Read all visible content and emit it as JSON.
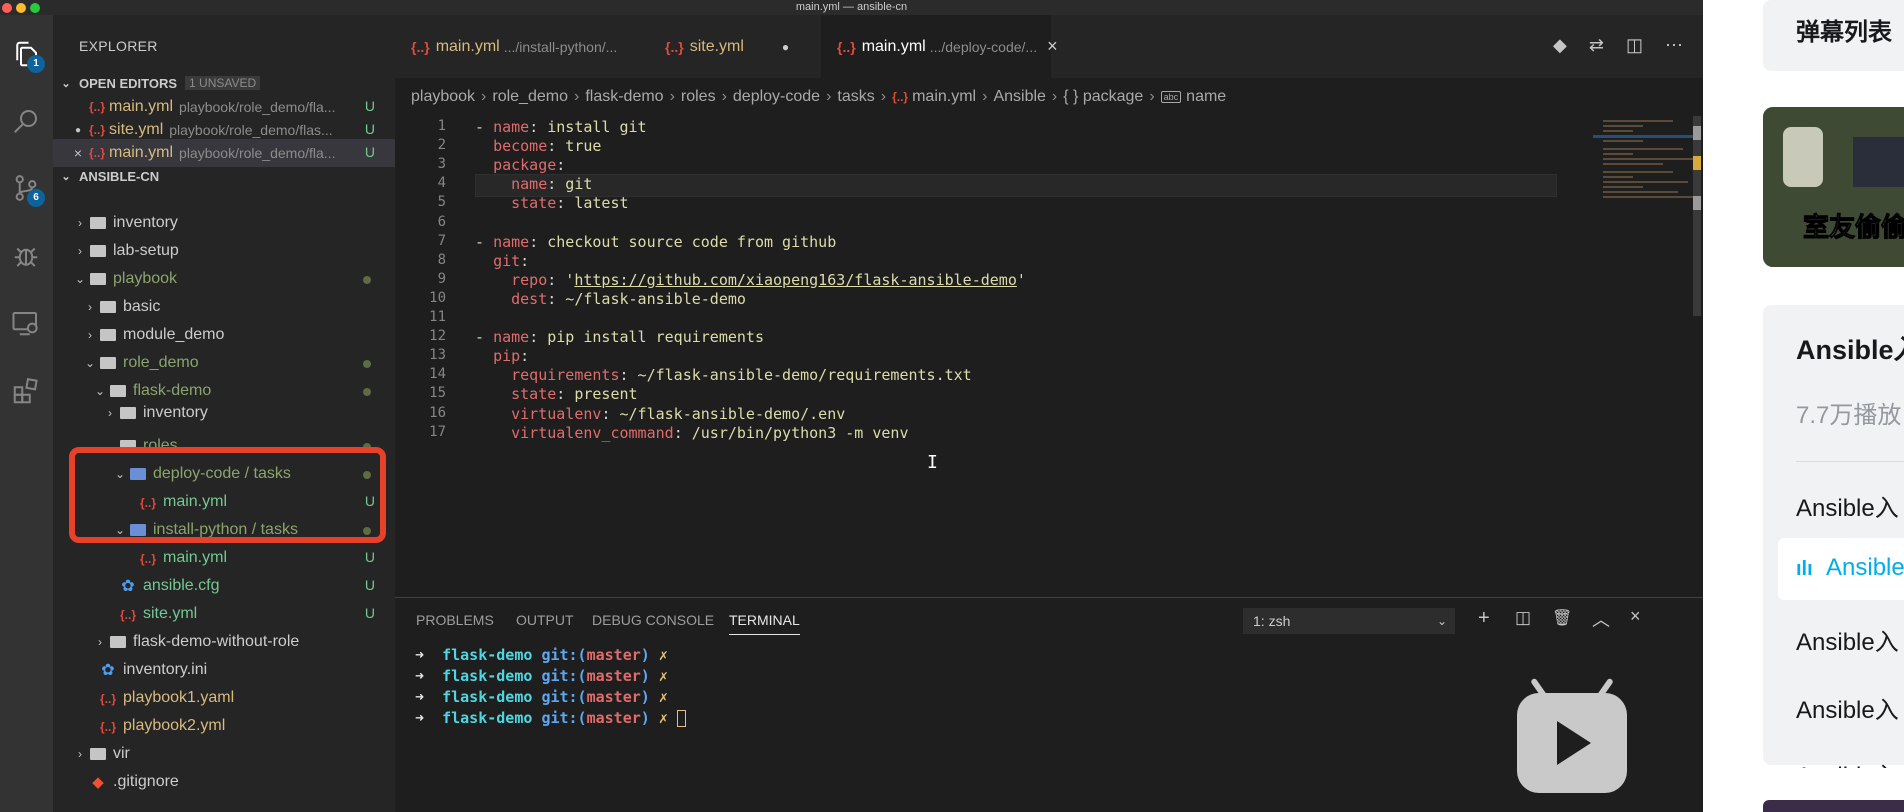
{
  "window": {
    "title": "main.yml — ansible-cn"
  },
  "activity": {
    "items": [
      {
        "name": "explorer-icon",
        "badge": "1"
      },
      {
        "name": "search-icon",
        "badge": ""
      },
      {
        "name": "source-control-icon",
        "badge": "6"
      },
      {
        "name": "debug-icon",
        "badge": ""
      },
      {
        "name": "remote-explorer-icon",
        "badge": ""
      },
      {
        "name": "extensions-icon",
        "badge": ""
      }
    ]
  },
  "sidebar": {
    "title": "EXPLORER",
    "open_editors": {
      "label": "OPEN EDITORS",
      "unsaved": "1 UNSAVED",
      "items": [
        {
          "name": "main.yml",
          "path": "playbook/role_demo/fla...",
          "status": "U"
        },
        {
          "name": "site.yml",
          "path": "playbook/role_demo/flas...",
          "status": "U"
        },
        {
          "name": "main.yml",
          "path": "playbook/role_demo/fla...",
          "status": "U"
        }
      ]
    },
    "project": {
      "label": "ANSIBLE-CN",
      "tree": [
        {
          "name": "inventory",
          "type": "folder",
          "status": ""
        },
        {
          "name": "lab-setup",
          "type": "folder",
          "status": ""
        },
        {
          "name": "playbook",
          "type": "folder-open",
          "status": "dot"
        },
        {
          "name": "basic",
          "type": "folder",
          "status": ""
        },
        {
          "name": "module_demo",
          "type": "folder",
          "status": ""
        },
        {
          "name": "role_demo",
          "type": "folder-open",
          "status": "dot"
        },
        {
          "name": "flask-demo",
          "type": "folder-open",
          "status": "dot"
        },
        {
          "name": "inventory",
          "type": "folder",
          "status": ""
        },
        {
          "name": "roles",
          "type": "folder-open",
          "status": "dot"
        },
        {
          "name": "deploy-code / tasks",
          "type": "folder-open",
          "status": "dot"
        },
        {
          "name": "main.yml",
          "type": "yml",
          "status": "U"
        },
        {
          "name": "install-python / tasks",
          "type": "folder-open",
          "status": "dot"
        },
        {
          "name": "main.yml",
          "type": "yml",
          "status": "U"
        },
        {
          "name": "ansible.cfg",
          "type": "cfg",
          "status": "U"
        },
        {
          "name": "site.yml",
          "type": "yml",
          "status": "U"
        },
        {
          "name": "flask-demo-without-role",
          "type": "folder",
          "status": ""
        },
        {
          "name": "inventory.ini",
          "type": "cfg",
          "status": ""
        },
        {
          "name": "playbook1.yaml",
          "type": "yml",
          "status": ""
        },
        {
          "name": "playbook2.yml",
          "type": "yml",
          "status": ""
        },
        {
          "name": "vir",
          "type": "folder",
          "status": ""
        },
        {
          "name": ".gitignore",
          "type": "git",
          "status": ""
        }
      ]
    }
  },
  "tabs": [
    {
      "name": "main.yml",
      "path": ".../install-python/...",
      "active": false
    },
    {
      "name": "site.yml",
      "path": "",
      "active": false
    },
    {
      "name": "main.yml",
      "path": ".../deploy-code/...",
      "active": true
    }
  ],
  "breadcrumbs": [
    "playbook",
    "role_demo",
    "flask-demo",
    "roles",
    "deploy-code",
    "tasks",
    "main.yml",
    "Ansible",
    "{ } package",
    "name"
  ],
  "code": {
    "lines": [
      "- name: install git",
      "  become: true",
      "  package:",
      "    name: git",
      "    state: latest",
      "",
      "- name: checkout source code from github",
      "  git:",
      "    repo: 'https://github.com/xiaopeng163/flask-ansible-demo'",
      "    dest: ~/flask-ansible-demo",
      "",
      "- name: pip install requirements",
      "  pip:",
      "    requirements: ~/flask-ansible-demo/requirements.txt",
      "    state: present",
      "    virtualenv: ~/flask-ansible-demo/.env",
      "    virtualenv_command: /usr/bin/python3 -m venv"
    ]
  },
  "panel": {
    "tabs": [
      "PROBLEMS",
      "OUTPUT",
      "DEBUG CONSOLE",
      "TERMINAL"
    ],
    "active_tab": "TERMINAL",
    "terminal_select": "1: zsh",
    "lines": [
      {
        "arrow": "➜",
        "dir": "flask-demo",
        "git": "git:(",
        "branch": "master",
        "close": ")",
        "mark": "✗"
      },
      {
        "arrow": "➜",
        "dir": "flask-demo",
        "git": "git:(",
        "branch": "master",
        "close": ")",
        "mark": "✗"
      },
      {
        "arrow": "➜",
        "dir": "flask-demo",
        "git": "git:(",
        "branch": "master",
        "close": ")",
        "mark": "✗"
      },
      {
        "arrow": "➜",
        "dir": "flask-demo",
        "git": "git:(",
        "branch": "master",
        "close": ")",
        "mark": "✗"
      }
    ]
  },
  "bilibili": {
    "danmaku": "弹幕列表",
    "video_caption": "室友偷偷",
    "title": "Ansible入",
    "views": "7.7万播放",
    "playlist": [
      "Ansible入",
      "Ansible",
      "Ansible入",
      "Ansible入",
      "Ansible入"
    ]
  },
  "colors": {
    "highlight": "#e8412a",
    "accent": "#0e639c",
    "bili_blue": "#00aeec"
  }
}
